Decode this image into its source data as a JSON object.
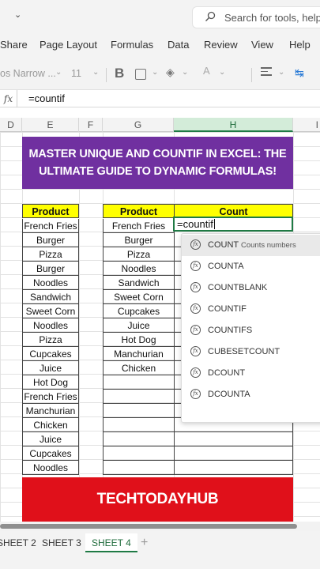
{
  "search": {
    "placeholder": "Search for tools, help,"
  },
  "menu": [
    "Share",
    "Page Layout",
    "Formulas",
    "Data",
    "Review",
    "View",
    "Help"
  ],
  "toolbar": {
    "font_name": "os Narrow ...",
    "font_size": "11",
    "bold": "B",
    "fill": "◈",
    "font_color": "A",
    "wrap": "↹"
  },
  "formula_bar": {
    "fx": "fx",
    "value": "=countif"
  },
  "columns": [
    "D",
    "E",
    "F",
    "G",
    "H",
    "I"
  ],
  "selected_column": "H",
  "banner_title": {
    "line1": "MASTER UNIQUE AND COUNTIF IN EXCEL: THE",
    "line2": "ULTIMATE GUIDE TO DYNAMIC FORMULAS!"
  },
  "table_e": {
    "header": "Product",
    "rows": [
      "French Fries",
      "Burger",
      "Pizza",
      "Burger",
      "Noodles",
      "Sandwich",
      "Sweet Corn",
      "Noodles",
      "Pizza",
      "Cupcakes",
      "Juice",
      "Hot Dog",
      "French Fries",
      "Manchurian",
      "Chicken",
      "Juice",
      "Cupcakes",
      "Noodles"
    ]
  },
  "table_g": {
    "header": "Product",
    "rows": [
      "French Fries",
      "Burger",
      "Pizza",
      "Noodles",
      "Sandwich",
      "Sweet Corn",
      "Cupcakes",
      "Juice",
      "Hot Dog",
      "Manchurian",
      "Chicken",
      "",
      "",
      "",
      "",
      "",
      "",
      ""
    ]
  },
  "table_h": {
    "header": "Count",
    "active_value": "=countif"
  },
  "autocomplete": [
    {
      "label": "COUNT",
      "desc": "Counts numbers",
      "highlighted": true
    },
    {
      "label": "COUNTA",
      "desc": ""
    },
    {
      "label": "COUNTBLANK",
      "desc": ""
    },
    {
      "label": "COUNTIF",
      "desc": ""
    },
    {
      "label": "COUNTIFS",
      "desc": ""
    },
    {
      "label": "CUBESETCOUNT",
      "desc": ""
    },
    {
      "label": "DCOUNT",
      "desc": ""
    },
    {
      "label": "DCOUNTA",
      "desc": ""
    }
  ],
  "autocomplete_icon": "fx",
  "footer_banner": "TECHTODAYHUB",
  "sheets": [
    "SHEET 2",
    "SHEET 3",
    "SHEET 4"
  ],
  "active_sheet": "SHEET 4",
  "sheet_add": "+",
  "colors": {
    "title_banner": "#7030a0",
    "header_fill": "#ffff00",
    "footer_banner": "#e0101a",
    "excel_green": "#1f7a45"
  }
}
